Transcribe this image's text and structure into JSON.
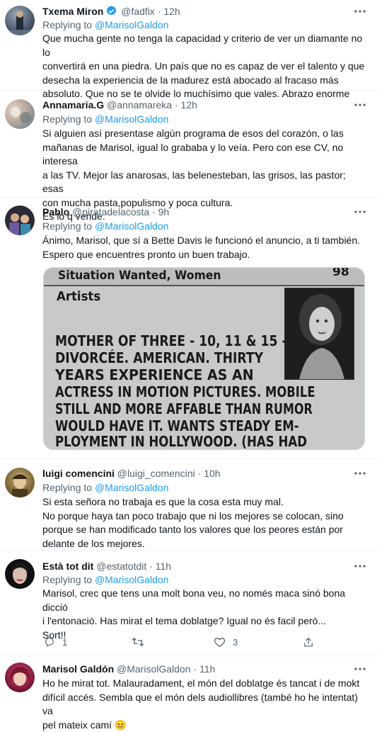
{
  "tweets": [
    {
      "name": "Txema Miron",
      "handle": "@fadfix",
      "time": "12h",
      "verified": true,
      "replying_prefix": "Replying to",
      "replying_to": "@MarisolGaldon",
      "text": "Que mucha gente no tenga la capacidad y criterio de ver un diamante no lo\nconvertirá en una piedra. Un país que no es capaz de ver el talento y que\ndesecha la experiencia de la madurez está abocado al fracaso más\nabsoluto. Que no se te olvide lo muchísimo que vales. Abrazo enorme"
    },
    {
      "name": "Annamaria.G",
      "handle": "@annamareka",
      "time": "12h",
      "replying_prefix": "Replying to",
      "replying_to": "@MarisolGaldon",
      "text": "Si alguien así presentase algún programa de esos del corazón, o las\nmañanas de Marisol, igual lo grababa y lo veía. Pero con ese CV, no interesa\na las TV. Mejor las anarosas, las belenesteban, las grisos, las pastor; esas\ncon mucha pasta,populismo y poca cultura.\nEs lo q vende."
    },
    {
      "name": "Pablo",
      "handle": "@piratadelacosta",
      "time": "9h",
      "replying_prefix": "Replying to",
      "replying_to": "@MarisolGaldon",
      "text": "Ánimo, Marisol, que sí a Bette Davis le funcionó el anuncio, a ti también.\nEspero que encuentres pronto un buen trabajo.",
      "image": {
        "header": "Situation Wanted, Women",
        "page_number": "98",
        "section": "Artists",
        "lines": [
          "MOTHER OF THREE - 10, 11 & 15 -",
          "DIVORCÉE. AMERICAN. THIRTY",
          "YEARS EXPERIENCE AS AN",
          "ACTRESS IN MOTION PICTURES. MOBILE",
          "STILL AND MORE AFFABLE THAN RUMOR",
          "WOULD HAVE IT. WANTS STEADY EM-",
          "PLOYMENT IN HOLLYWOOD. (HAS HAD"
        ]
      }
    },
    {
      "name": "luigi comencini",
      "handle": "@luigi_comencini",
      "time": "10h",
      "replying_prefix": "Replying to",
      "replying_to": "@MarisolGaldon",
      "text": "Si esta señora no trabaja es que la cosa esta muy mal.\nNo porque haya tan poco trabajo que ni los mejores se colocan, sino\nporque se han modificado tanto los valores que los peores están por\ndelante de los mejores."
    },
    {
      "name": "Està tot dit",
      "handle": "@estatotdit",
      "time": "11h",
      "replying_prefix": "Replying to",
      "replying_to": "@MarisolGaldon",
      "text": "Marisol, crec que tens una molt bona veu, no només maca sinó bona dicció\ni l'entonació. Has mirat el tema doblatge? Igual no és facil però...\nSort!!",
      "actions": {
        "replies": "1",
        "retweets": "",
        "likes": "3"
      }
    },
    {
      "name": "Marisol Galdón",
      "handle": "@MarisolGaldon",
      "time": "11h",
      "text": "Ho he mirat tot. Malauradament, el món del doblatge és tancat i de mokt\ndifícil accés. Sembla que el món dels audiollibres (també ho he intentat) va\npel mateix camí 😐"
    }
  ],
  "separator": "·",
  "colors": {
    "accent": "#1d9bf0",
    "secondary": "#536471",
    "verified": "#1d9bf0"
  },
  "icons": [
    "more-icon",
    "verified-icon",
    "reply-icon",
    "retweet-icon",
    "like-icon",
    "share-icon"
  ]
}
